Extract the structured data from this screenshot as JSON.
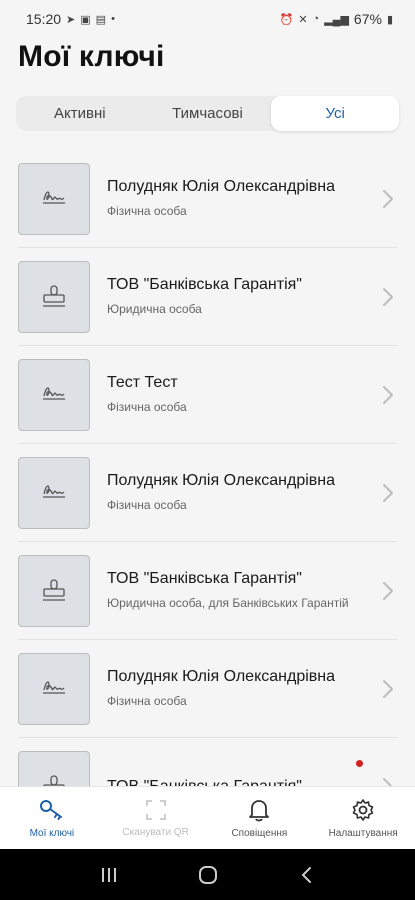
{
  "status_bar": {
    "time": "15:20",
    "battery": "67%"
  },
  "page": {
    "title": "Мої ключі"
  },
  "tabs": [
    {
      "label": "Активні",
      "active": false
    },
    {
      "label": "Тимчасові",
      "active": false
    },
    {
      "label": "Усі",
      "active": true
    }
  ],
  "keys": [
    {
      "icon": "signature-icon",
      "title": "Полудняк Юлія Олександрівна",
      "subtitle": "Фізична особа"
    },
    {
      "icon": "stamp-icon",
      "title": "ТОВ \"Банківська Гарантія\"",
      "subtitle": "Юридична особа"
    },
    {
      "icon": "signature-icon",
      "title": "Тест Тест",
      "subtitle": "Фізична особа"
    },
    {
      "icon": "signature-icon",
      "title": "Полудняк Юлія Олександрівна",
      "subtitle": "Фізична особа"
    },
    {
      "icon": "stamp-icon",
      "title": "ТОВ \"Банківська Гарантія\"",
      "subtitle": "Юридична особа, для Банківських Гарантій"
    },
    {
      "icon": "signature-icon",
      "title": "Полудняк Юлія Олександрівна",
      "subtitle": "Фізична особа"
    },
    {
      "icon": "stamp-icon",
      "title": "ТОВ \"Банківська Гарантія\"",
      "subtitle": "",
      "unread": true
    }
  ],
  "bottom_nav": [
    {
      "label": "Мої ключі",
      "icon": "key-icon",
      "state": "active"
    },
    {
      "label": "Сканувати QR",
      "icon": "qr-scan-icon",
      "state": "disabled"
    },
    {
      "label": "Сповіщення",
      "icon": "bell-icon",
      "state": "normal"
    },
    {
      "label": "Налаштування",
      "icon": "settings-icon",
      "state": "normal"
    }
  ],
  "colors": {
    "accent": "#1e5fa8",
    "unread_dot": "#d32020"
  }
}
